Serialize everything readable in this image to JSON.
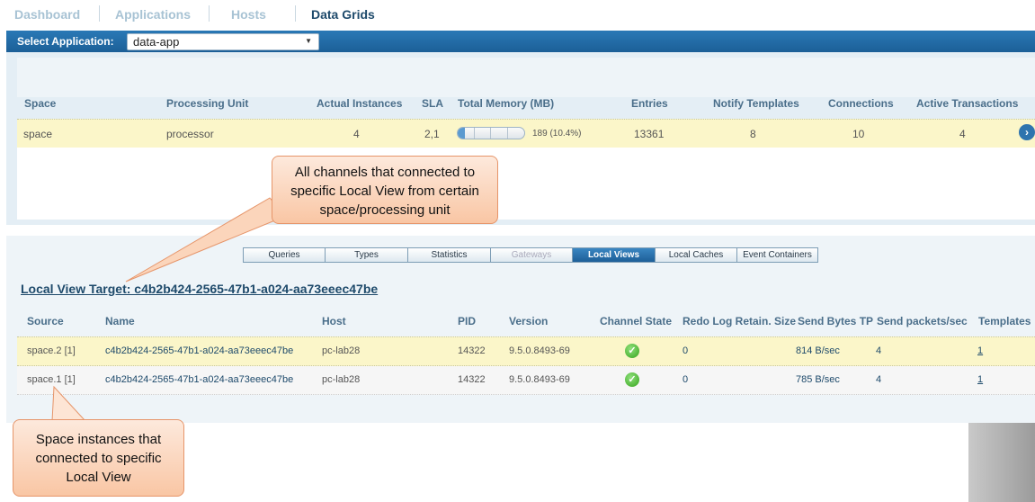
{
  "nav": {
    "tabs": [
      {
        "label": "Dashboard",
        "active": false
      },
      {
        "label": "Applications",
        "active": false
      },
      {
        "label": "Hosts",
        "active": false
      },
      {
        "label": "Data Grids",
        "active": true
      }
    ]
  },
  "app_bar": {
    "label": "Select Application:",
    "selected": "data-app"
  },
  "space_grid": {
    "columns": [
      "Space",
      "Processing Unit",
      "Actual Instances",
      "SLA",
      "Total Memory (MB)",
      "Entries",
      "Notify Templates",
      "Connections",
      "Active Transactions"
    ],
    "row": {
      "space": "space",
      "processing_unit": "processor",
      "actual_instances": "4",
      "sla": "2,1",
      "memory_text": "189 (10.4%)",
      "memory_fraction": 0.104,
      "entries": "13361",
      "notify_templates": "8",
      "connections": "10",
      "active_transactions": "4"
    }
  },
  "tabs": [
    {
      "label": "Queries",
      "state": "normal"
    },
    {
      "label": "Types",
      "state": "normal"
    },
    {
      "label": "Statistics",
      "state": "normal"
    },
    {
      "label": "Gateways",
      "state": "disabled"
    },
    {
      "label": "Local Views",
      "state": "active"
    },
    {
      "label": "Local Caches",
      "state": "normal"
    },
    {
      "label": "Event Containers",
      "state": "normal"
    }
  ],
  "local_view": {
    "target_label": "Local View Target: c4b2b424-2565-47b1-a024-aa73eeec47be",
    "columns": [
      "Source",
      "Name",
      "Host",
      "PID",
      "Version",
      "Channel State",
      "Redo Log Retain. Size",
      "Send Bytes TP",
      "Send packets/sec",
      "Templates"
    ],
    "rows": [
      {
        "source": "space.2 [1]",
        "name": "c4b2b424-2565-47b1-a024-aa73eeec47be",
        "host": "pc-lab28",
        "pid": "14322",
        "version": "9.5.0.8493-69",
        "channel_state": "ok",
        "redo": "0",
        "send_bytes": "814 B/sec",
        "send_packets": "4",
        "templates": "1"
      },
      {
        "source": "space.1 [1]",
        "name": "c4b2b424-2565-47b1-a024-aa73eeec47be",
        "host": "pc-lab28",
        "pid": "14322",
        "version": "9.5.0.8493-69",
        "channel_state": "ok",
        "redo": "0",
        "send_bytes": "785 B/sec",
        "send_packets": "4",
        "templates": "1"
      }
    ]
  },
  "callouts": {
    "channels": "All channels that connected to specific Local View from certain space/processing unit",
    "instances": "Space instances that connected to specific Local View"
  },
  "icons": {
    "dropdown": "chevron-down-icon",
    "row_detail": "chevron-right-icon",
    "channel_state": "check-circle-icon"
  },
  "colors": {
    "accent": "#1c5f97",
    "highlight_row": "#fbf6c9",
    "callout": "#f9c6a4",
    "ok": "#35a41d"
  }
}
